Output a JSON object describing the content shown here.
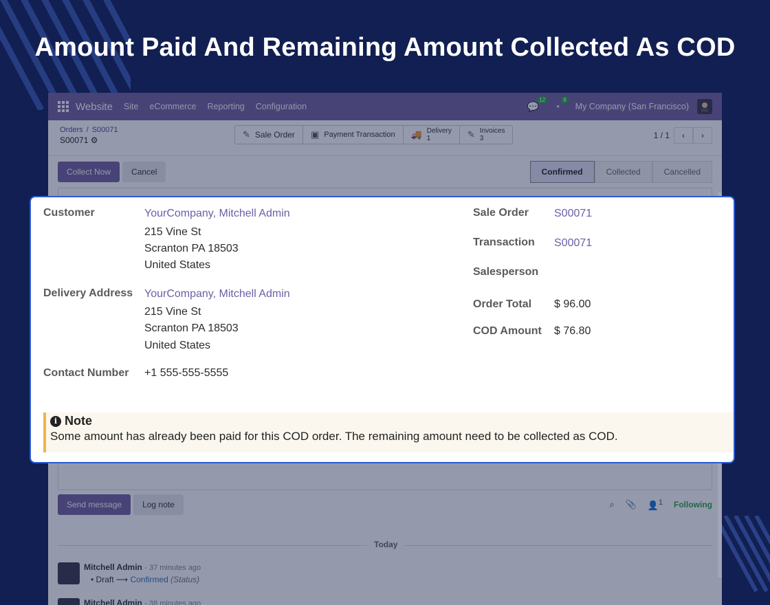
{
  "headline": "Amount Paid And Remaining Amount Collected As COD",
  "navbar": {
    "app": "Website",
    "menu": [
      "Site",
      "eCommerce",
      "Reporting",
      "Configuration"
    ],
    "messages_count": "12",
    "activities_count": "8",
    "company": "My Company (San Francisco)"
  },
  "breadcrumb": {
    "parent": "Orders",
    "current": "S00071",
    "record": "S00071"
  },
  "smart_buttons": {
    "sale_order": "Sale Order",
    "payment_transaction": "Payment Transaction",
    "delivery_label": "Delivery",
    "delivery_count": "1",
    "invoices_label": "Invoices",
    "invoices_count": "3"
  },
  "pager": {
    "value": "1 / 1"
  },
  "actions": {
    "collect_now": "Collect Now",
    "cancel": "Cancel"
  },
  "stages": [
    "Confirmed",
    "Collected",
    "Cancelled"
  ],
  "form": {
    "customer_label": "Customer",
    "customer_name": "YourCompany, Mitchell Admin",
    "customer_street": "215 Vine St",
    "customer_city": "Scranton PA 18503",
    "customer_country": "United States",
    "delivery_label": "Delivery Address",
    "delivery_name": "YourCompany, Mitchell Admin",
    "delivery_street": "215 Vine St",
    "delivery_city": "Scranton PA 18503",
    "delivery_country": "United States",
    "contact_label": "Contact Number",
    "contact_value": "+1 555-555-5555",
    "sale_order_label": "Sale Order",
    "sale_order_value": "S00071",
    "transaction_label": "Transaction",
    "transaction_value": "S00071",
    "salesperson_label": "Salesperson",
    "order_total_label": "Order Total",
    "order_total_value": "$ 96.00",
    "cod_amount_label": "COD Amount",
    "cod_amount_value": "$ 76.80"
  },
  "note": {
    "title": "Note",
    "text": "Some amount has already been paid for this COD order. The remaining amount need to be collected as COD."
  },
  "chatter": {
    "send_message": "Send message",
    "log_note": "Log note",
    "followers_count": "1",
    "following": "Following",
    "today": "Today",
    "msg1_author": "Mitchell Admin",
    "msg1_time": "- 37 minutes ago",
    "msg1_from": "Draft",
    "msg1_to": "Confirmed",
    "msg1_field": "(Status)",
    "msg2_author": "Mitchell Admin",
    "msg2_time": "- 38 minutes ago"
  }
}
